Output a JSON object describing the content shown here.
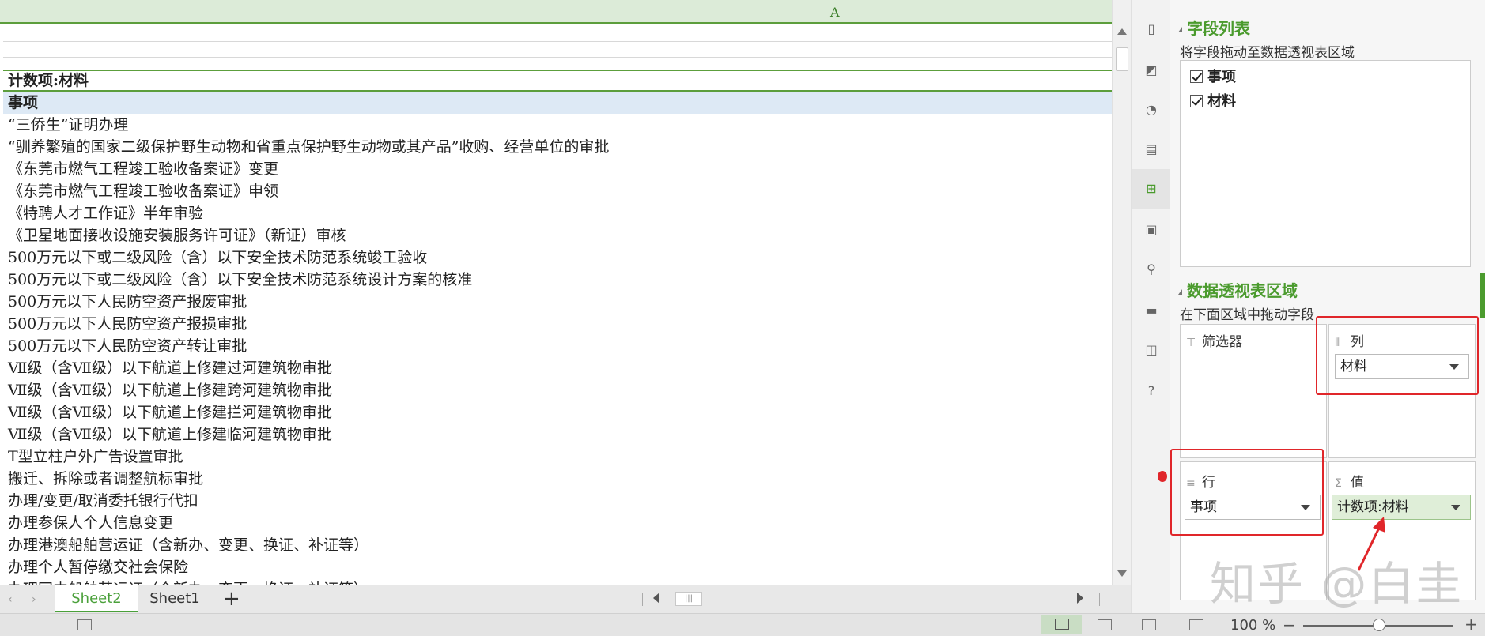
{
  "grid": {
    "column_letter": "A",
    "pivot_title": "计数项:材料",
    "row_header": "事项",
    "rows": [
      "“三侨生”证明办理",
      "“驯养繁殖的国家二级保护野生动物和省重点保护野生动物或其产品”收购、经营单位的审批",
      "《东莞市燃气工程竣工验收备案证》变更",
      "《东莞市燃气工程竣工验收备案证》申领",
      "《特聘人才工作证》半年审验",
      "《卫星地面接收设施安装服务许可证》（新证）审核",
      "500万元以下或二级风险（含）以下安全技术防范系统竣工验收",
      "500万元以下或二级风险（含）以下安全技术防范系统设计方案的核准",
      "500万元以下人民防空资产报废审批",
      "500万元以下人民防空资产报损审批",
      "500万元以下人民防空资产转让审批",
      "Ⅶ级（含Ⅶ级）以下航道上修建过河建筑物审批",
      "Ⅶ级（含Ⅶ级）以下航道上修建跨河建筑物审批",
      "Ⅶ级（含Ⅶ级）以下航道上修建拦河建筑物审批",
      "Ⅶ级（含Ⅶ级）以下航道上修建临河建筑物审批",
      "T型立柱户外广告设置审批",
      "搬迁、拆除或者调整航标审批",
      "办理/变更/取消委托银行代扣",
      "办理参保人个人信息变更",
      "办理港澳船舶营运证（含新办、变更、换证、补证等）",
      "办理个人暂停缴交社会保险",
      "办理国内船舶营运证（含新办、变更、换证、补证等）"
    ]
  },
  "tabs": {
    "sheet2": "Sheet2",
    "sheet1": "Sheet1",
    "add": "+"
  },
  "status": {
    "zoom": "100 %",
    "minus": "−",
    "plus": "+"
  },
  "panel": {
    "field_list_title": "字段列表",
    "field_list_hint": "将字段拖动至数据透视表区域",
    "fields": [
      "事项",
      "材料"
    ],
    "areas_title": "数据透视表区域",
    "areas_hint": "在下面区域中拖动字段",
    "filter_label": "筛选器",
    "column_label": "列",
    "column_value": "材料",
    "row_label": "行",
    "row_value": "事项",
    "values_label": "值",
    "values_value": "计数项:材料"
  },
  "watermark": "知乎 @白圭",
  "icons": {
    "strip": [
      "file-icon",
      "shape-icon",
      "style-icon",
      "page-icon",
      "pivot-icon",
      "image-icon",
      "location-icon",
      "toolbox-icon",
      "backup-icon",
      "help-icon"
    ]
  },
  "colors": {
    "accent_green": "#4b9b2e",
    "header_green": "#dcebd8",
    "annotation_red": "#e0262a"
  }
}
